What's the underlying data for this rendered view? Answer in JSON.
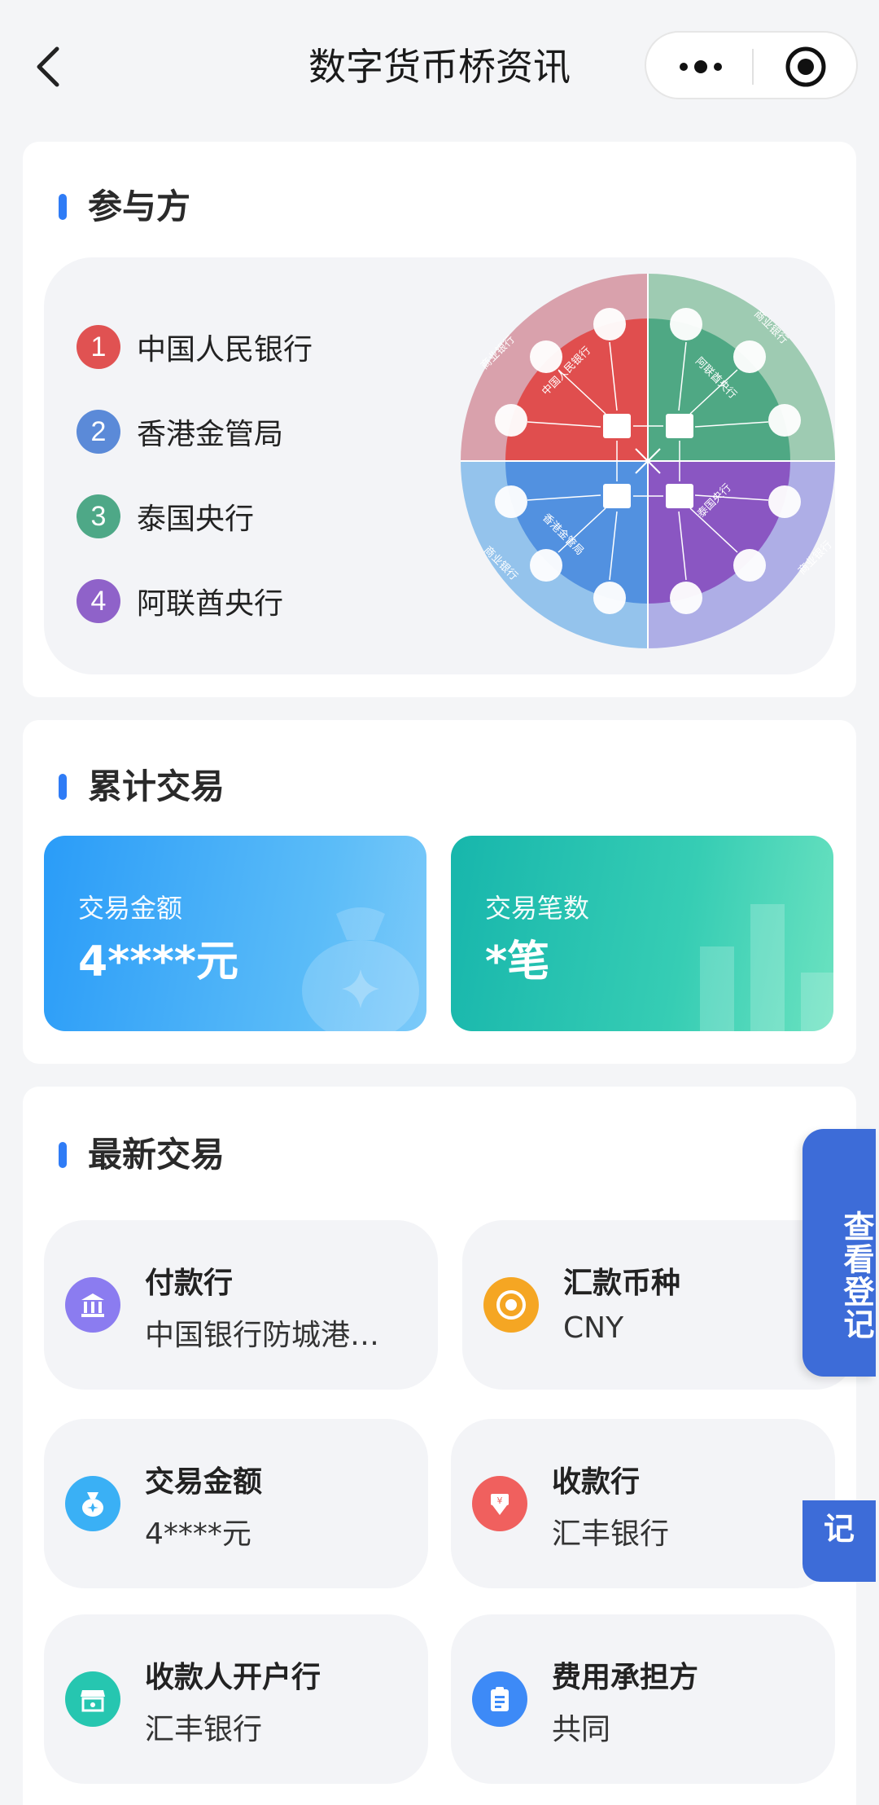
{
  "header": {
    "title": "数字货币桥资讯"
  },
  "participants": {
    "title": "参与方",
    "items": [
      {
        "num": "1",
        "name": "中国人民银行",
        "color": "#e05252"
      },
      {
        "num": "2",
        "name": "香港金管局",
        "color": "#5b8ad8"
      },
      {
        "num": "3",
        "name": "泰国央行",
        "color": "#4ea887"
      },
      {
        "num": "4",
        "name": "阿联酋央行",
        "color": "#8f62c9"
      }
    ],
    "wheel": {
      "center_labels": [
        "中国人民银行",
        "阿联酋央行",
        "泰国央行",
        "香港金管局"
      ],
      "outer_labels": [
        "商业银行",
        "商业银行",
        "商业银行",
        "商业银行"
      ],
      "colors": {
        "red": "#e04e4e",
        "green": "#4fa884",
        "blue": "#5291e0",
        "purple": "#8a56c2"
      }
    }
  },
  "stats": {
    "title": "累计交易",
    "amount": {
      "label": "交易金额",
      "value": "4****元"
    },
    "count": {
      "label": "交易笔数",
      "value": "*笔"
    }
  },
  "latest": {
    "title": "最新交易",
    "items": [
      {
        "label": "付款行",
        "value": "中国银行防城港…",
        "icon": "bank-icon",
        "color": "#8b7cf0"
      },
      {
        "label": "汇款币种",
        "value": "CNY",
        "icon": "coin-icon",
        "color": "#f5a623"
      },
      {
        "label": "交易金额",
        "value": "4****元",
        "icon": "money-bag-icon",
        "color": "#3ab0f5"
      },
      {
        "label": "收款行",
        "value": "汇丰银行",
        "icon": "yuan-down-icon",
        "color": "#f0605e"
      },
      {
        "label": "收款人开户行",
        "value": "汇丰银行",
        "icon": "store-icon",
        "color": "#26c6b0"
      },
      {
        "label": "费用承担方",
        "value": "共同",
        "icon": "clipboard-icon",
        "color": "#3d8af7"
      }
    ]
  },
  "float_button": {
    "label": "查看登记",
    "ghost_label": "记"
  }
}
